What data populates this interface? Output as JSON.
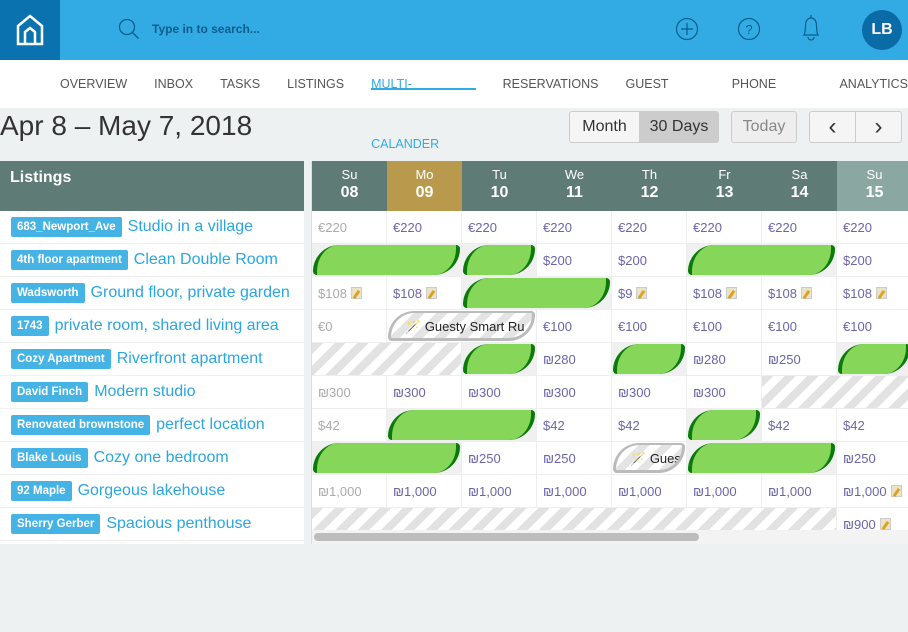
{
  "topbar": {
    "search_placeholder": "Type in to search...",
    "avatar": "LB",
    "icons": [
      "home-icon",
      "search-icon",
      "plus-circle-icon",
      "help-icon",
      "bell-icon"
    ]
  },
  "nav": [
    {
      "label": "OVERVIEW"
    },
    {
      "label": "INBOX"
    },
    {
      "label": "TASKS"
    },
    {
      "label": "LISTINGS"
    },
    {
      "label": "MULTI-CALANDER",
      "active": true
    },
    {
      "label": "RESERVATIONS"
    },
    {
      "label": "GUEST BOOK"
    },
    {
      "label": "PHONE BOOK"
    },
    {
      "label": "ANALYTICS"
    }
  ],
  "toolbar": {
    "range": "Apr 8 – May 7, 2018",
    "month": "Month",
    "days30": "30 Days",
    "today": "Today",
    "prev": "‹",
    "next": "›"
  },
  "listings_header": "Listings",
  "days": [
    {
      "dn": "Su",
      "dd": "08"
    },
    {
      "dn": "Mo",
      "dd": "09",
      "today": true
    },
    {
      "dn": "Tu",
      "dd": "10"
    },
    {
      "dn": "We",
      "dd": "11"
    },
    {
      "dn": "Th",
      "dd": "12"
    },
    {
      "dn": "Fr",
      "dd": "13"
    },
    {
      "dn": "Sa",
      "dd": "14"
    },
    {
      "dn": "Su",
      "dd": "15",
      "weekend": true
    }
  ],
  "colors": {
    "header": "#5f7b75",
    "today": "#b99a4c",
    "booking": "#86d65a",
    "accent": "#32abe4"
  },
  "listings": [
    {
      "name": "683_Newport_Ave",
      "title": "Studio in a village",
      "cells": [
        {
          "p": "€220",
          "dim": true
        },
        {
          "p": "€220"
        },
        {
          "p": "€220"
        },
        {
          "p": "€220"
        },
        {
          "p": "€220"
        },
        {
          "p": "€220"
        },
        {
          "p": "€220"
        },
        {
          "p": "€220"
        }
      ]
    },
    {
      "name": "4th floor apartment",
      "title": "Clean Double Room",
      "cells": [
        {
          "t": "booking",
          "span": 2
        },
        {
          "t": "booking",
          "span": 1
        },
        {
          "p": "$200"
        },
        {
          "p": "$200"
        },
        {
          "t": "booking",
          "span": 2
        },
        {
          "p": "$200"
        }
      ]
    },
    {
      "name": "Wadsworth",
      "title": "Ground floor, private garden",
      "cells": [
        {
          "p": "$108",
          "dim": true,
          "note": true
        },
        {
          "p": "$108",
          "note": true
        },
        {
          "t": "booking",
          "span": 2
        },
        {
          "p": "$9",
          "note": true
        },
        {
          "p": "$108",
          "note": true
        },
        {
          "p": "$108",
          "note": true
        },
        {
          "p": "$108",
          "note": true
        }
      ]
    },
    {
      "name": "1743",
      "title": "private room, shared living area",
      "cells": [
        {
          "p": "€0",
          "dim": true
        },
        {
          "t": "smart",
          "span": 2,
          "label": "Guesty Smart Ru"
        },
        {
          "p": "€100"
        },
        {
          "p": "€100"
        },
        {
          "p": "€100"
        },
        {
          "p": "€100"
        },
        {
          "p": "€100"
        }
      ]
    },
    {
      "name": "Cozy Apartment",
      "title": "Riverfront apartment",
      "cells": [
        {
          "t": "blocked",
          "span": 2
        },
        {
          "t": "booking",
          "span": 1
        },
        {
          "p": "₪280"
        },
        {
          "t": "booking",
          "span": 1
        },
        {
          "p": "₪280"
        },
        {
          "p": "₪250"
        },
        {
          "t": "booking",
          "span": 1
        }
      ]
    },
    {
      "name": "David Finch",
      "title": "Modern studio",
      "cells": [
        {
          "p": "₪300",
          "dim": true
        },
        {
          "p": "₪300"
        },
        {
          "p": "₪300"
        },
        {
          "p": "₪300"
        },
        {
          "p": "₪300"
        },
        {
          "p": "₪300"
        },
        {
          "t": "blocked",
          "span": 2
        }
      ]
    },
    {
      "name": "Renovated brownstone",
      "title": "perfect location",
      "cells": [
        {
          "p": "$42",
          "dim": true
        },
        {
          "t": "booking",
          "span": 2
        },
        {
          "p": "$42"
        },
        {
          "p": "$42"
        },
        {
          "t": "booking",
          "span": 1
        },
        {
          "p": "$42"
        },
        {
          "p": "$42"
        }
      ]
    },
    {
      "name": "Blake Louis",
      "title": "Cozy one bedroom",
      "cells": [
        {
          "t": "booking",
          "span": 2
        },
        {
          "p": "₪250"
        },
        {
          "p": "₪250"
        },
        {
          "t": "smart",
          "span": 1,
          "label": "Gues"
        },
        {
          "t": "booking",
          "span": 2
        },
        {
          "p": "₪250"
        }
      ]
    },
    {
      "name": "92 Maple",
      "title": "Gorgeous lakehouse",
      "cells": [
        {
          "p": "₪1,000",
          "dim": true
        },
        {
          "p": "₪1,000"
        },
        {
          "p": "₪1,000"
        },
        {
          "p": "₪1,000"
        },
        {
          "p": "₪1,000"
        },
        {
          "p": "₪1,000"
        },
        {
          "p": "₪1,000"
        },
        {
          "p": "₪1,000",
          "note": true
        }
      ]
    },
    {
      "name": "Sherry Gerber",
      "title": "Spacious penthouse",
      "cells": [
        {
          "t": "blocked",
          "span": 7
        },
        {
          "p": "₪900",
          "note": true
        }
      ]
    }
  ]
}
